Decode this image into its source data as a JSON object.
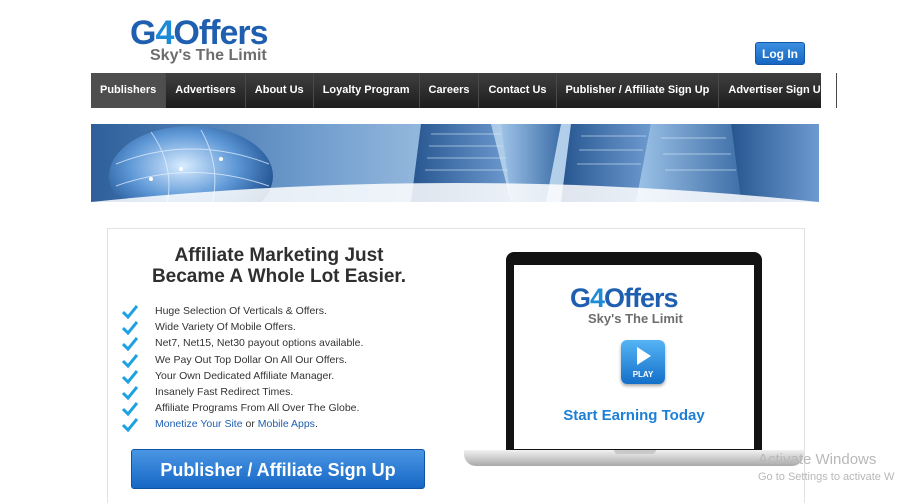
{
  "header": {
    "logo": {
      "word_g": "G",
      "word_four": "4",
      "word_rest": "Offers",
      "tagline": "Sky's The Limit"
    },
    "login_label": "Log In"
  },
  "nav": {
    "items": [
      {
        "label": "Publishers"
      },
      {
        "label": "Advertisers"
      },
      {
        "label": "About Us"
      },
      {
        "label": "Loyalty Program"
      },
      {
        "label": "Careers"
      },
      {
        "label": "Contact Us"
      },
      {
        "label": "Publisher / Affiliate Sign Up"
      },
      {
        "label": "Advertiser Sign Up"
      }
    ]
  },
  "main": {
    "headline_line1": "Affiliate Marketing Just",
    "headline_line2": "Became A Whole Lot Easier.",
    "features": [
      "Huge Selection Of Verticals & Offers.",
      "Wide Variety Of Mobile Offers.",
      "Net7, Net15, Net30 payout options available.",
      "We Pay Out Top Dollar On All Our Offers.",
      "Your Own Dedicated Affiliate Manager.",
      "Insanely Fast Redirect Times.",
      "Affiliate Programs From All Over The Globe."
    ],
    "last_feature": {
      "link1": "Monetize Your Site",
      "or": " or ",
      "link2": "Mobile Apps",
      "end": "."
    },
    "cta_label": "Publisher / Affiliate Sign Up"
  },
  "laptop_screen": {
    "logo_g": "G",
    "logo_four": "4",
    "logo_rest": "Offers",
    "tagline": "Sky's The Limit",
    "play_label": "PLAY",
    "earn_text": "Start Earning Today"
  },
  "watermark": {
    "line1": "Activate Windows",
    "line2": "Go to Settings to activate W"
  },
  "colors": {
    "brand_blue": "#1f5fb0",
    "accent_blue": "#1d8bd6",
    "nav_bg": "#2a2a2a",
    "check": "#1da1e2"
  }
}
